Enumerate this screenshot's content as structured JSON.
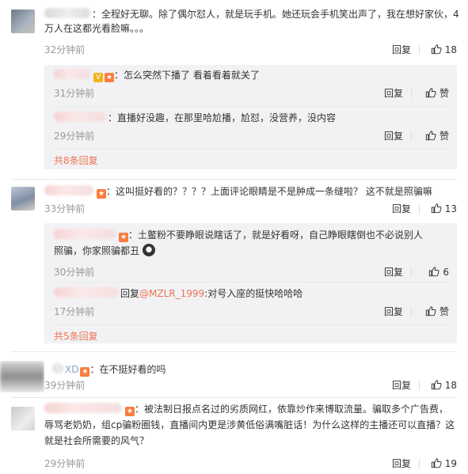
{
  "comments": [
    {
      "text": "全程好无聊。除了偶尔怼人，就是玩手机。她还玩会手机笑出声了，我在想好家伙，4",
      "text2": "万人在这都光看脸嘛。。。",
      "time": "32分钟前",
      "reply": "回复",
      "likes": "18",
      "replies": [
        {
          "text": "怎么突然下播了 看着看着就关了",
          "time": "31分钟前",
          "reply": "回复",
          "likes": "赞"
        },
        {
          "text": "直播好没趣，在那里哈尬播，尬怼，没营养，没内容",
          "time": "29分钟前",
          "reply": "回复",
          "likes": "赞"
        }
      ],
      "more": "共8条回复"
    },
    {
      "text": "这叫挺好看的？？？？上面评论眼睛是不是肿成一条缝啦？ 这不就是照骗嘛",
      "time": "33分钟前",
      "reply": "回复",
      "likes": "13",
      "replies": [
        {
          "text": "土鳖粉不要睁眼说瞎话了，就是好看呀，自己睁眼瞎倒也不必说别人",
          "text2": "照骗，你家照骗都丑",
          "time": "30分钟前",
          "reply": "回复",
          "likes": "6"
        },
        {
          "prefix": "回复",
          "mention": "@MZLR_1999",
          "text": ":对号入座的挺快哈哈哈",
          "time": "17分钟前",
          "reply": "回复",
          "likes": "赞"
        }
      ],
      "more": "共5条回复"
    },
    {
      "name": "XD",
      "text": "在不挺好看的吗",
      "time": "39分钟前",
      "reply": "回复",
      "likes": "18"
    },
    {
      "text": "被法制日报点名过的劣质网红，依靠炒作来博取流量。骗取多个广告费，",
      "text2": "辱骂老奶奶，组cp骗粉圈钱，直播间内更是涉黄低俗满嘴脏话！为什么这样的主播还可以直播？这",
      "text3": "就是社会所需要的风气？",
      "time": "29分钟前",
      "reply": "回复",
      "likes": "19"
    }
  ],
  "colors": {
    "accent": "#eb7350",
    "meta": "#999999",
    "reply_bg": "#f2f2f5"
  }
}
